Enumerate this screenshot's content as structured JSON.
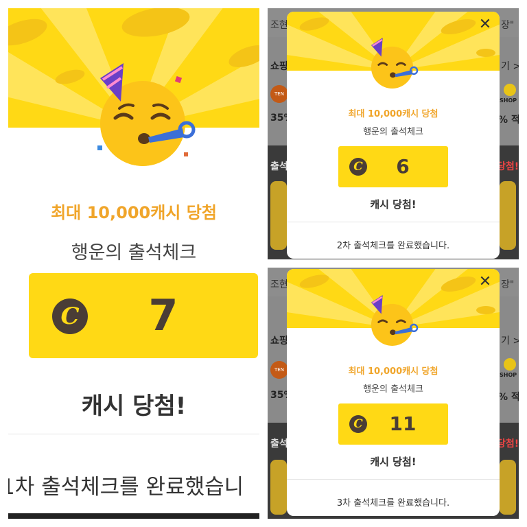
{
  "panels": [
    {
      "max_prize": "최대 10,000캐시 당첨",
      "subtitle": "행운의 출석체크",
      "coin_symbol": "C",
      "amount": "7",
      "result": "캐시 당첨!",
      "completion": "1차 출석체크를 완료했습니"
    },
    {
      "max_prize": "최대 10,000캐시 당첨",
      "subtitle": "행운의 출석체크",
      "coin_symbol": "C",
      "amount": "6",
      "result": "캐시 당첨!",
      "completion": "2차 출석체크를 완료했습니다.",
      "close_symbol": "✕"
    },
    {
      "max_prize": "최대 10,000캐시 당첨",
      "subtitle": "행운의 출석체크",
      "coin_symbol": "C",
      "amount": "11",
      "result": "캐시 당첨!",
      "completion": "3차 출석체크를 완료했습니다.",
      "close_symbol": "✕"
    }
  ],
  "background_fragments": {
    "top_text_left": "조현",
    "top_text_right": "장\"",
    "shopping_label": "쇼핑",
    "chevron": "기 >",
    "percent_left": "35%",
    "percent_right": "% 적립",
    "attendance_left": "출석",
    "attendance_right": "당첨!",
    "shop_label": "SHOP",
    "logo_left": "TEN"
  },
  "colors": {
    "brand_yellow": "#ffd915",
    "coin_brown": "#4a3d36",
    "accent_orange": "#f0a52a"
  },
  "icons": {
    "emoji": "party-face-emoji",
    "coin": "cash-coin-icon",
    "close": "close-icon"
  }
}
